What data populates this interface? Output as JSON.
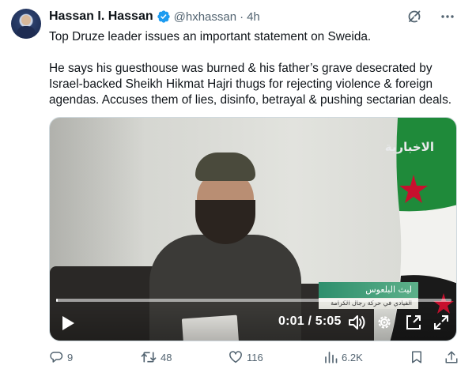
{
  "author": {
    "name": "Hassan I. Hassan",
    "handle": "@hxhassan",
    "separator": "·",
    "time": "4h",
    "verified": true,
    "verified_color": "#1d9bf0"
  },
  "header_icons": [
    "grok-icon",
    "more-options-icon"
  ],
  "tweet": {
    "paragraph_1": "Top Druze leader issues an important statement on Sweida.",
    "paragraph_2": "He says his guesthouse was burned & his father’s grave desecrated by Israel-backed Sheikh Hikmat Hajri thugs for rejecting violence & foreign agendas. Accuses them of lies, disinfo, betrayal & pushing sectarian deals."
  },
  "video": {
    "channel_logo": "الاخبارية",
    "lower_third_name": "ليث البلعوس",
    "lower_third_title": "القيادي في حركة رجال الكرامة",
    "time_display": "0:01 / 5:05",
    "progress_fraction": 0.003,
    "controls": [
      "play-icon",
      "volume-icon",
      "settings-gear-icon",
      "picture-in-picture-icon",
      "fullscreen-icon"
    ]
  },
  "actions": {
    "replies": "9",
    "reposts": "48",
    "likes": "116",
    "views": "6.2K",
    "icon_color": "#536471"
  }
}
